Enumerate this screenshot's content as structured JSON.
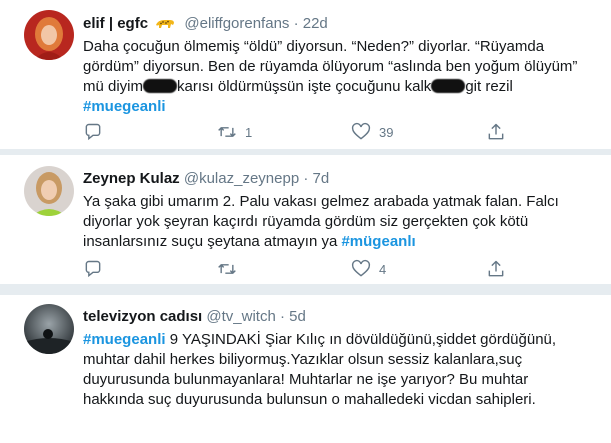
{
  "tweets": [
    {
      "name": "elif | egfc",
      "badge_icon": "leopard-emoji",
      "handle": "@eliffgorenfans",
      "time": "22d",
      "text_a": "Daha çocuğun ölmemiş “öldü” diyorsun. “Neden?” diyorlar. “Rüyamda gördüm” diyorsun. Ben de rüyamda ölüyorum “aslında ben yoğum ölüyüm” mü diyim",
      "text_b": "karısı öldürmüşsün işte çocuğunu kalk",
      "text_c": "git rezil",
      "hashtag": "#muegeanli",
      "replies": "",
      "retweets": "1",
      "likes": "39"
    },
    {
      "name": "Zeynep Kulaz",
      "handle": "@kulaz_zeynepp",
      "time": "7d",
      "text": "Ya şaka gibi umarım 2. Palu vakası gelmez arabada yatmak falan. Falcı diyorlar yok şeyran kaçırdı rüyamda gördüm siz gerçekten çok kötü insanlarsınız suçu şeytana atmayın ya ",
      "hashtag": "#mügeanlı",
      "replies": "",
      "retweets": "",
      "likes": "4"
    },
    {
      "name": "televizyon cadısı",
      "handle": "@tv_witch",
      "time": "5d",
      "hashtag": "#muegeanli",
      "text": " 9 YAŞINDAKİ Şiar Kılıç ın dövüldüğünü,şiddet gördüğünü, muhtar dahil herkes biliyormuş.Yazıklar olsun sessiz kalanlara,suç duyurusunda bulunmayanlara! Muhtarlar ne işe yarıyor? Bu muhtar hakkında suç duyurusunda bulunsun  o mahalledeki  vicdan sahipleri."
    }
  ],
  "separator": "·",
  "icons": [
    "reply-icon",
    "retweet-icon",
    "like-icon",
    "share-icon"
  ],
  "colors": {
    "hashtag": "#1b95e0",
    "muted": "#657786",
    "divider": "#e6ecf0"
  }
}
